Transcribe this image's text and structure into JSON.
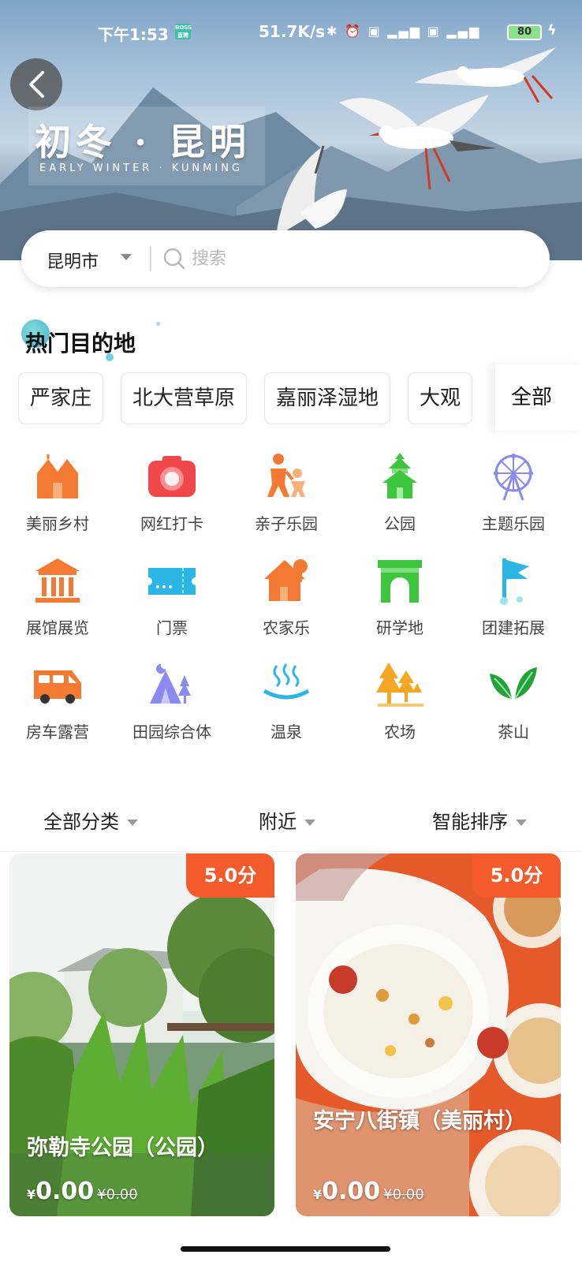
{
  "status_bar": {
    "time": "下午1:53",
    "app_badge": "BOSS 直聘",
    "net_speed": "51.7K/s",
    "battery": "80"
  },
  "banner": {
    "title": "初冬 · 昆明",
    "subtitle": "EARLY WINTER · KUNMING"
  },
  "search": {
    "city": "昆明市",
    "placeholder": "搜索"
  },
  "hot_destinations": {
    "title": "热门目的地",
    "items": [
      "严家庄",
      "北大营草原",
      "嘉丽泽湿地",
      "大观"
    ],
    "all_label": "全部"
  },
  "categories": [
    {
      "label": "美丽乡村",
      "icon": "village-icon"
    },
    {
      "label": "网红打卡",
      "icon": "camera-icon"
    },
    {
      "label": "亲子乐园",
      "icon": "parent-child-icon"
    },
    {
      "label": "公园",
      "icon": "pagoda-icon"
    },
    {
      "label": "主题乐园",
      "icon": "ferris-wheel-icon"
    },
    {
      "label": "展馆展览",
      "icon": "museum-icon"
    },
    {
      "label": "门票",
      "icon": "ticket-icon"
    },
    {
      "label": "农家乐",
      "icon": "farmhouse-icon"
    },
    {
      "label": "研学地",
      "icon": "arch-icon"
    },
    {
      "label": "团建拓展",
      "icon": "flag-icon"
    },
    {
      "label": "房车露营",
      "icon": "rv-icon"
    },
    {
      "label": "田园综合体",
      "icon": "tent-icon"
    },
    {
      "label": "温泉",
      "icon": "hot-spring-icon"
    },
    {
      "label": "农场",
      "icon": "trees-icon"
    },
    {
      "label": "茶山",
      "icon": "tea-leaf-icon"
    }
  ],
  "filters": {
    "category": "全部分类",
    "nearby": "附近",
    "sort": "智能排序"
  },
  "cards": [
    {
      "name": "弥勒寺公园（公园）",
      "score": "5.0分",
      "currency": "¥",
      "price": "0.00",
      "old_price": "¥0.00"
    },
    {
      "name": "安宁八街镇（美丽村）",
      "score": "5.0分",
      "currency": "¥",
      "price": "0.00",
      "old_price": "¥0.00"
    }
  ],
  "colors": {
    "accent_orange": "#f35a2c",
    "icon_orange": "#f47a33",
    "icon_green": "#3ec53e",
    "icon_blue": "#2bb6e6",
    "icon_purple": "#8a8af0"
  }
}
